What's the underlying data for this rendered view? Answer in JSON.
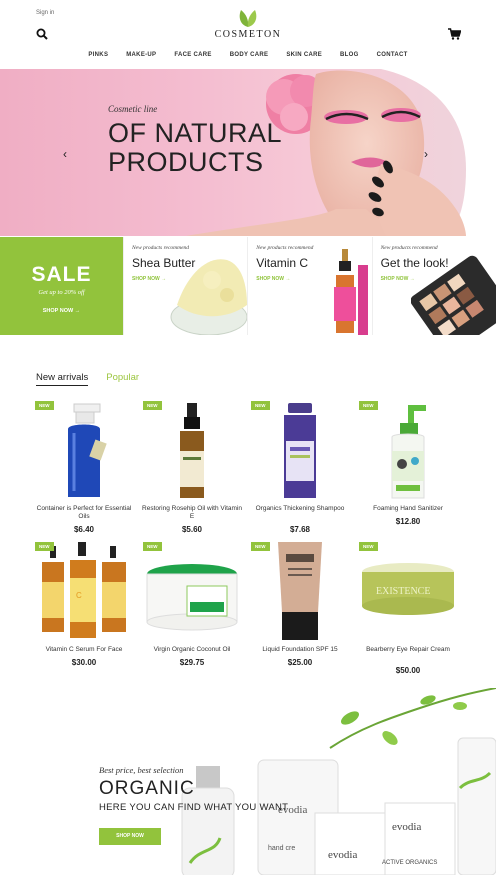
{
  "header": {
    "sign_in": "Sign in",
    "logo_text": "COSMETON",
    "search_icon": "search-icon",
    "cart_icon": "cart-icon"
  },
  "nav": [
    "PINKS",
    "MAKE-UP",
    "FACE CARE",
    "BODY CARE",
    "SKIN CARE",
    "BLOG",
    "CONTACT"
  ],
  "hero": {
    "subtitle": "Cosmetic line",
    "title_line1": "OF NATURAL",
    "title_line2": "PRODUCTS",
    "prev_arrow": "‹",
    "next_arrow": "›"
  },
  "promo": {
    "sale_title": "SALE",
    "sale_subtitle": "Get up to 20% off",
    "sale_button": "SHOP NOW →",
    "cards": [
      {
        "pre": "New products recommend",
        "name": "Shea Butter",
        "shop": "SHOP NOW →"
      },
      {
        "pre": "New products recommend",
        "name": "Vitamin C",
        "shop": "SHOP NOW →"
      },
      {
        "pre": "New products recommend",
        "name": "Get the look!",
        "shop": "SHOP NOW →"
      }
    ]
  },
  "tabs": [
    {
      "label": "New arrivals",
      "active": true
    },
    {
      "label": "Popular",
      "active": false
    }
  ],
  "products": [
    {
      "badge": "NEW",
      "name": "Container is Perfect for Essential Oils",
      "price": "$6.40"
    },
    {
      "badge": "NEW",
      "name": "Restoring Rosehip Oil with Vitamin E",
      "price": "$5.60"
    },
    {
      "badge": "NEW",
      "name": "Organics Thickening Shampoo",
      "price": "$7.68"
    },
    {
      "badge": "NEW",
      "name": "Foaming Hand Sanitizer",
      "price": "$12.80"
    },
    {
      "badge": "NEW",
      "name": "Vitamin C Serum For Face",
      "price": "$30.00"
    },
    {
      "badge": "NEW",
      "name": "Virgin Organic Coconut Oil",
      "price": "$29.75"
    },
    {
      "badge": "NEW",
      "name": "Liquid Foundation SPF 15",
      "price": "$25.00"
    },
    {
      "badge": "NEW",
      "name": "Bearberry Eye Repair Cream",
      "price": "$50.00"
    }
  ],
  "bottom_banner": {
    "subtitle": "Best price, best selection",
    "title": "ORGANIC",
    "description": "HERE YOU CAN FIND WHAT YOU WANT",
    "button": "SHOP NOW",
    "product_labels": [
      "evodia",
      "evodia",
      "evodia",
      "hand cre",
      "ACTIVE ORGANICS"
    ]
  },
  "colors": {
    "accent": "#92c33c",
    "hero_pink": "#f4bdd0"
  }
}
